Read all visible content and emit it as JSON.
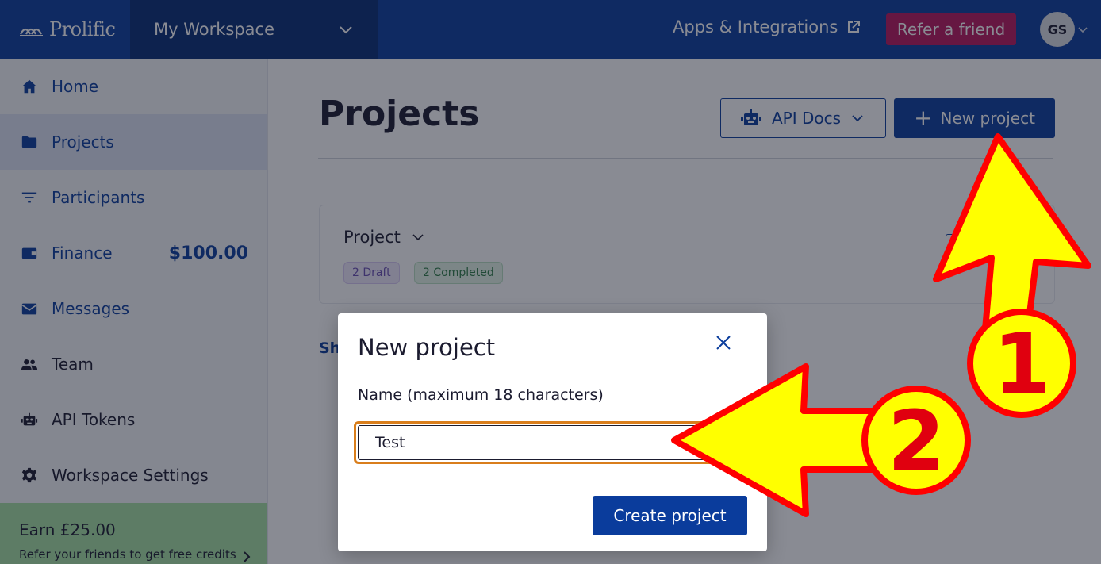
{
  "topbar": {
    "brand": "Prolific",
    "workspace": "My Workspace",
    "apps_link": "Apps & Integrations",
    "refer_button": "Refer a friend",
    "avatar_initials": "GS"
  },
  "sidebar": {
    "items": [
      {
        "label": "Home",
        "icon": "home-icon"
      },
      {
        "label": "Projects",
        "icon": "folder-icon"
      },
      {
        "label": "Participants",
        "icon": "filter-icon"
      },
      {
        "label": "Finance",
        "icon": "wallet-icon",
        "amount": "$100.00"
      },
      {
        "label": "Messages",
        "icon": "envelope-icon"
      },
      {
        "label": "Team",
        "icon": "team-icon"
      },
      {
        "label": "API Tokens",
        "icon": "robot-icon"
      },
      {
        "label": "Workspace Settings",
        "icon": "gear-icon"
      }
    ],
    "earn": {
      "title": "Earn £25.00",
      "subtitle": "Refer your friends to get free credits"
    }
  },
  "main": {
    "title": "Projects",
    "api_docs_button": "API Docs",
    "new_project_button": "New project",
    "project_card": {
      "name": "Project",
      "badges": [
        "2 Draft",
        "2 Completed"
      ]
    },
    "show_link": "Sh"
  },
  "modal": {
    "title": "New project",
    "field_label": "Name (maximum 18 characters)",
    "name_value": "Test",
    "create_button": "Create project"
  },
  "annotations": {
    "step1": "1",
    "step2": "2"
  },
  "colors": {
    "brand_blue": "#0a3c9c",
    "workspace_dark": "#062c74",
    "refer_pink": "#b8175c",
    "arrow_yellow": "#ffff00",
    "arrow_red": "#ff0000",
    "focus_orange": "#d97e1c"
  }
}
